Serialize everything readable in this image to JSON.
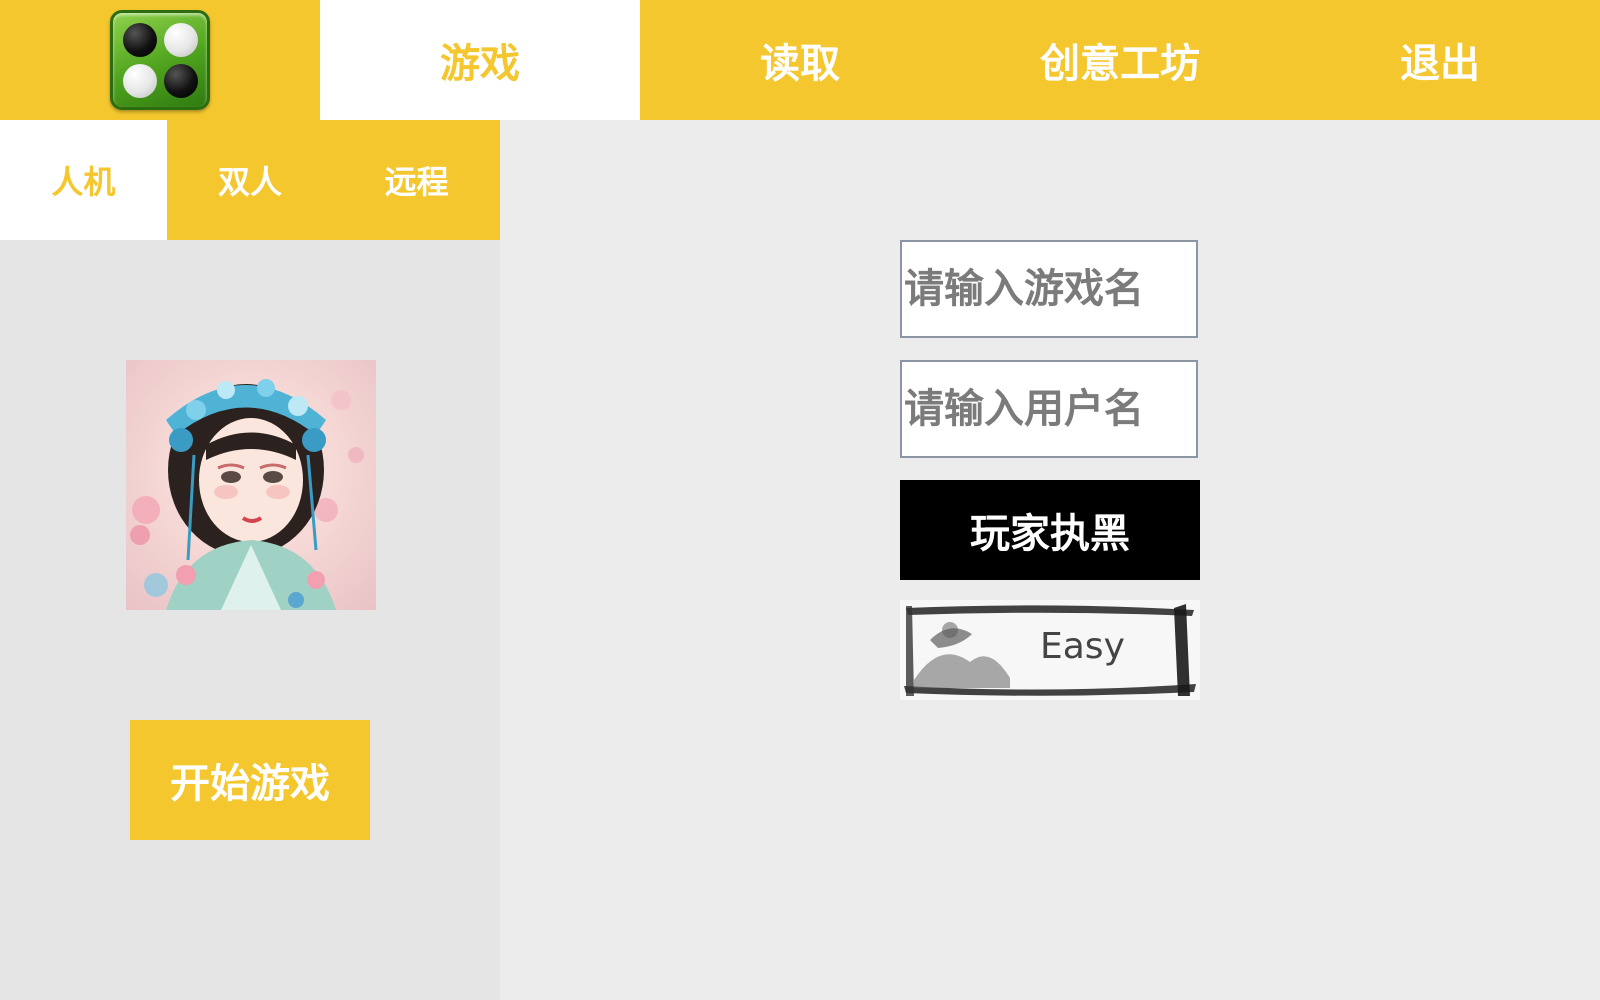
{
  "header": {
    "tabs": [
      {
        "label": "游戏",
        "active": true
      },
      {
        "label": "读取",
        "active": false
      },
      {
        "label": "创意工坊",
        "active": false
      },
      {
        "label": "退出",
        "active": false
      }
    ]
  },
  "sidebar": {
    "mode_tabs": [
      {
        "label": "人机",
        "active": true
      },
      {
        "label": "双人",
        "active": false
      },
      {
        "label": "远程",
        "active": false
      }
    ],
    "start_button": "开始游戏"
  },
  "form": {
    "game_name": {
      "placeholder": "请输入游戏名",
      "value": ""
    },
    "user_name": {
      "placeholder": "请输入用户名",
      "value": ""
    },
    "side_button": "玩家执黑",
    "difficulty": "Easy"
  },
  "colors": {
    "accent": "#f4c72e",
    "background": "#ececec",
    "sidebar_bg": "#e5e5e5"
  },
  "icons": {
    "logo": "reversi-board-icon",
    "avatar": "opera-girl-portrait"
  }
}
